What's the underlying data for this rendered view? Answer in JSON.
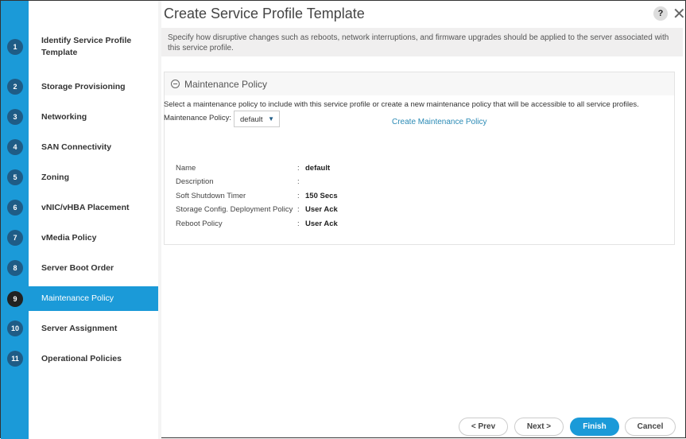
{
  "title": "Create Service Profile Template",
  "help_label": "?",
  "close_label": "✕",
  "description": "Specify how disruptive changes such as reboots, network interruptions, and firmware upgrades should be applied to the server associated with this service profile.",
  "steps": [
    {
      "num": "1",
      "label": "Identify Service Profile Template"
    },
    {
      "num": "2",
      "label": "Storage Provisioning"
    },
    {
      "num": "3",
      "label": "Networking"
    },
    {
      "num": "4",
      "label": "SAN Connectivity"
    },
    {
      "num": "5",
      "label": "Zoning"
    },
    {
      "num": "6",
      "label": "vNIC/vHBA Placement"
    },
    {
      "num": "7",
      "label": "vMedia Policy"
    },
    {
      "num": "8",
      "label": "Server Boot Order"
    },
    {
      "num": "9",
      "label": "Maintenance Policy"
    },
    {
      "num": "10",
      "label": "Server Assignment"
    },
    {
      "num": "11",
      "label": "Operational Policies"
    }
  ],
  "panel": {
    "title": "Maintenance Policy",
    "intro": "Select a maintenance policy to include with this service profile or create a new maintenance policy that will be accessible to all service profiles.",
    "policy_label": "Maintenance Policy:",
    "policy_value": "default",
    "create_link": "Create Maintenance Policy",
    "details": [
      {
        "key": "Name",
        "value": "default"
      },
      {
        "key": "Description",
        "value": ""
      },
      {
        "key": "Soft Shutdown Timer",
        "value": "150 Secs"
      },
      {
        "key": "Storage Config. Deployment Policy",
        "value": "User Ack"
      },
      {
        "key": "Reboot Policy",
        "value": "User Ack"
      }
    ]
  },
  "buttons": {
    "prev": "< Prev",
    "next": "Next >",
    "finish": "Finish",
    "cancel": "Cancel"
  }
}
